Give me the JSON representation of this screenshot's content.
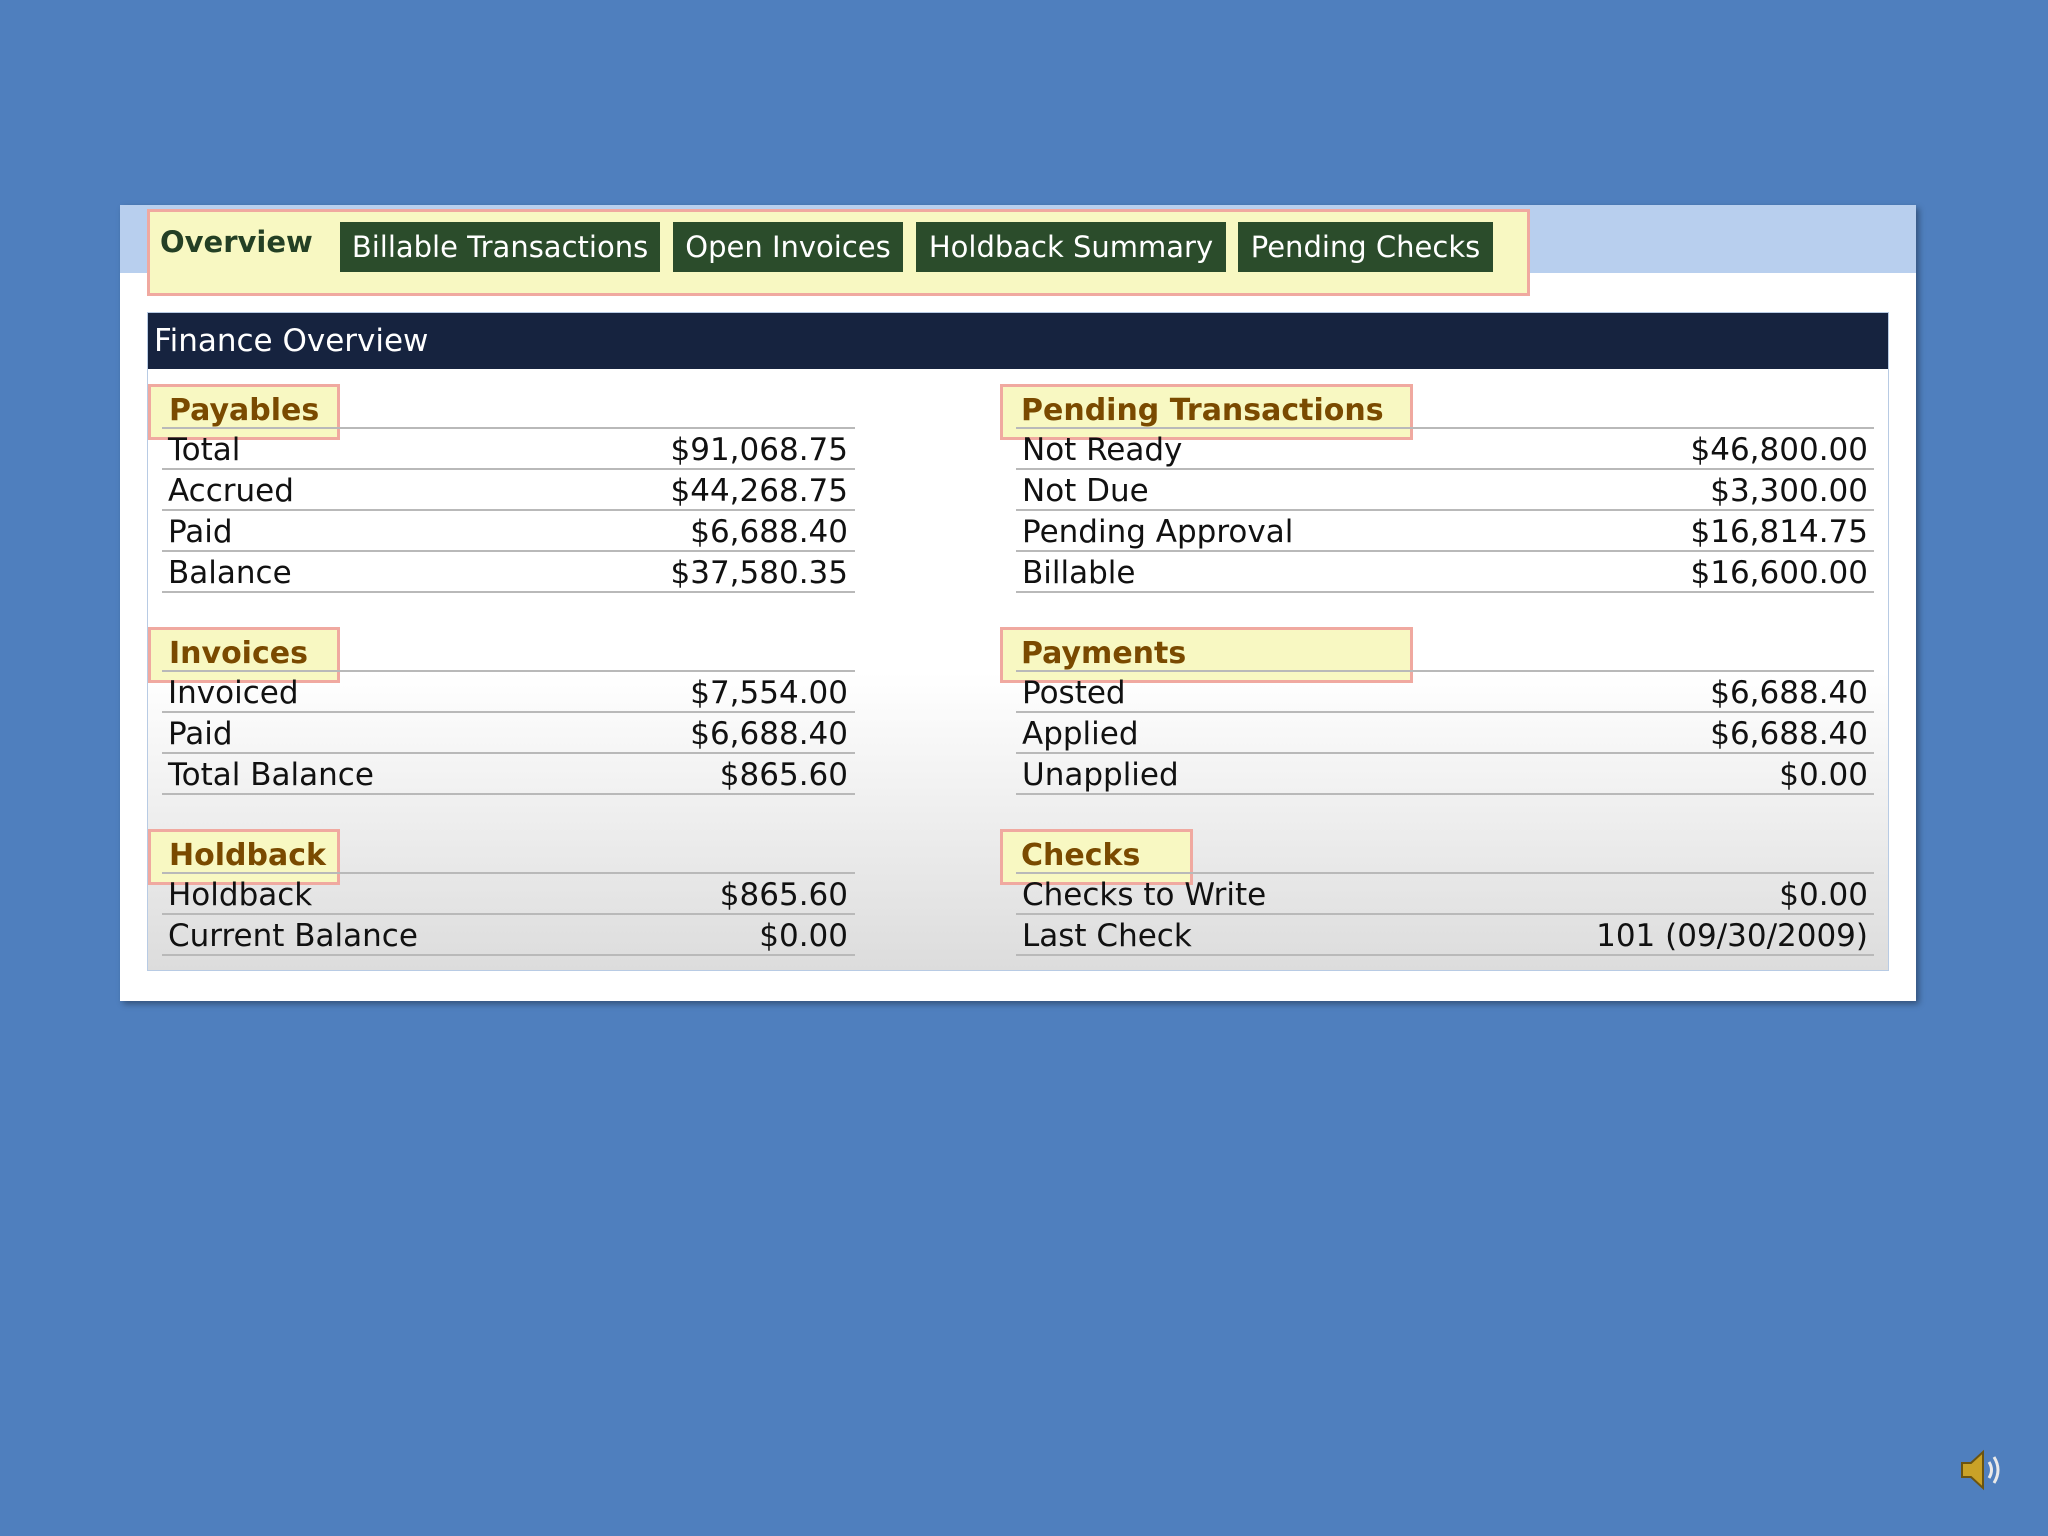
{
  "tabs": [
    {
      "label": "Overview",
      "active": true
    },
    {
      "label": "Billable Transactions",
      "active": false
    },
    {
      "label": "Open Invoices",
      "active": false
    },
    {
      "label": "Holdback Summary",
      "active": false
    },
    {
      "label": "Pending Checks",
      "active": false
    }
  ],
  "header": {
    "title": "Finance Overview"
  },
  "sections": {
    "payables": {
      "title": "Payables",
      "rows": [
        {
          "label": "Total",
          "value": "$91,068.75"
        },
        {
          "label": "Accrued",
          "value": "$44,268.75"
        },
        {
          "label": "Paid",
          "value": "$6,688.40"
        },
        {
          "label": "Balance",
          "value": "$37,580.35"
        }
      ]
    },
    "pending": {
      "title": "Pending Transactions",
      "rows": [
        {
          "label": "Not Ready",
          "value": "$46,800.00"
        },
        {
          "label": "Not Due",
          "value": "$3,300.00"
        },
        {
          "label": "Pending Approval",
          "value": "$16,814.75"
        },
        {
          "label": "Billable",
          "value": "$16,600.00"
        }
      ]
    },
    "invoices": {
      "title": "Invoices",
      "rows": [
        {
          "label": "Invoiced",
          "value": "$7,554.00"
        },
        {
          "label": "Paid",
          "value": "$6,688.40"
        },
        {
          "label": "Total Balance",
          "value": "$865.60"
        }
      ]
    },
    "payments": {
      "title": "Payments",
      "rows": [
        {
          "label": "Posted",
          "value": "$6,688.40"
        },
        {
          "label": "Applied",
          "value": "$6,688.40"
        },
        {
          "label": "Unapplied",
          "value": "$0.00"
        }
      ]
    },
    "holdback": {
      "title": "Holdback",
      "rows": [
        {
          "label": "Holdback",
          "value": "$865.60"
        },
        {
          "label": "Current Balance",
          "value": "$0.00"
        }
      ]
    },
    "checks": {
      "title": "Checks",
      "rows": [
        {
          "label": "Checks to Write",
          "value": "$0.00"
        },
        {
          "label": "Last Check",
          "value": "101 (09/30/2009)"
        }
      ]
    }
  },
  "colors": {
    "background": "#4f7fbe",
    "header_bar": "#16233f",
    "tab_inactive": "#2b4c2b",
    "highlight_fill": "#f8f8c2",
    "highlight_border": "#f0a9a0",
    "section_text": "#7a4a00"
  },
  "icons": {
    "sound": "speaker-icon"
  }
}
